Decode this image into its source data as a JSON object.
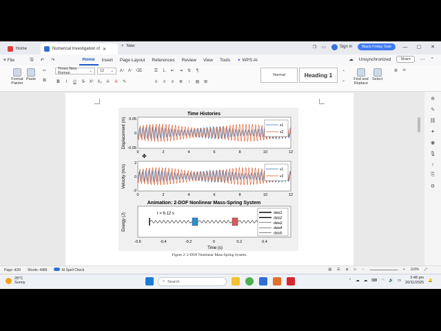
{
  "titlebar": {
    "tab_home": "Home",
    "tab_doc": "Numerical Investigation of",
    "new_tab": "New",
    "sign_in": "Sign in",
    "promo": "Black Friday Sale"
  },
  "menubar": {
    "file": "File",
    "items": [
      "Home",
      "Insert",
      "Page Layout",
      "References",
      "Review",
      "View",
      "Tools",
      "WPS AI"
    ],
    "unsynced": "Unsynchronized",
    "share": "Share"
  },
  "ribbon": {
    "format_painter": "Format Painter",
    "paste": "Paste",
    "font_name": "Times New Roman",
    "font_size": "12",
    "style_normal": "Normal",
    "style_heading": "Heading 1",
    "find_replace": "Find and Replace",
    "select": "Select"
  },
  "figure": {
    "chart1_title": "Time Histories",
    "chart1_ylabel": "Displacement (m)",
    "chart1_yticks": [
      "0.05",
      "0",
      "-0.05"
    ],
    "chart1_legend": [
      "x1",
      "x2"
    ],
    "chart2_ylabel": "Velocity (m/s)",
    "chart2_yticks": [
      "2",
      "0",
      "-2"
    ],
    "chart2_legend": [
      "v1",
      "v2"
    ],
    "xticks": [
      "0",
      "2",
      "4",
      "6",
      "8",
      "10",
      "12"
    ],
    "chart3_title": "Animation: 2-DOF Nonlinear Mass-Spring System",
    "chart3_ylabel": "Energy (J)",
    "chart3_time": "t = 6.12 s",
    "chart3_xticks": [
      "-0.6",
      "-0.4",
      "-0.2",
      "0",
      "0.2",
      "0.4"
    ],
    "chart3_xlabel": "Time (s)",
    "chart3_legend": [
      "data1",
      "data2",
      "data3",
      "data4",
      "data5"
    ],
    "colors": {
      "series1": "#2f6db5",
      "series2": "#d9501e",
      "mass1": "#2b8fcf",
      "mass2": "#d85a5a"
    }
  },
  "caption": "Figure 2: 2-DOF Nonlinear Mass-Spring System.",
  "status": {
    "page": "Page: 4/20",
    "words": "Words: 4489",
    "spell": "AI Spell Check",
    "zoom": "110%"
  },
  "taskbar": {
    "temp": "28°C",
    "weather": "Sunny",
    "search": "Search",
    "time": "2:48 pm",
    "date": "20/11/2025"
  }
}
